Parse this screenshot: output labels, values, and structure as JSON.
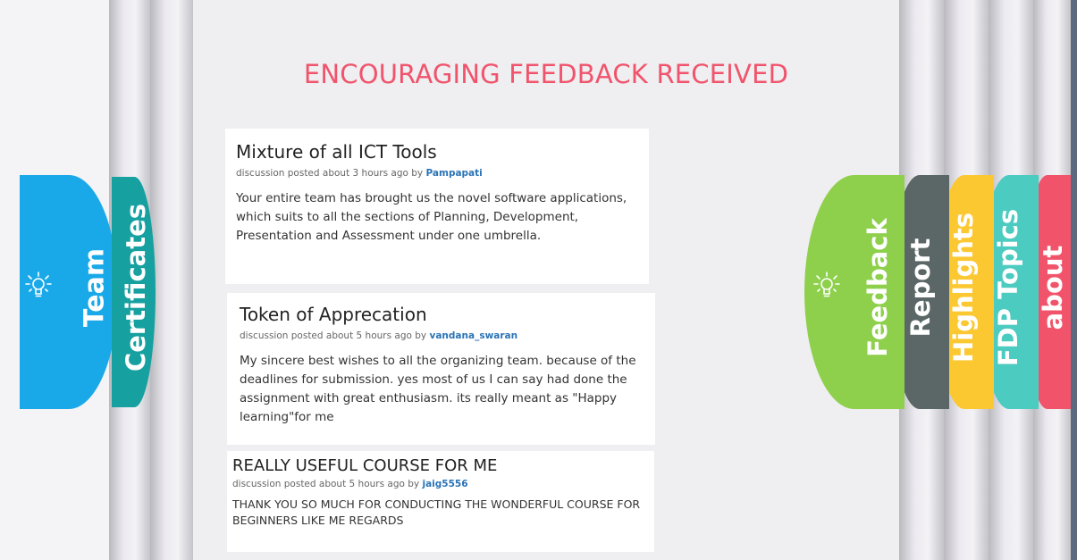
{
  "page": {
    "title": "ENCOURAGING FEEDBACK RECEIVED"
  },
  "left_tabs": [
    {
      "label": "Team",
      "color": "#1aa9e8",
      "icon": "lightbulb-icon"
    },
    {
      "label": "Certificates",
      "color": "#17a0a0"
    }
  ],
  "right_tabs": [
    {
      "label": "Feedback",
      "color": "#8ed04b",
      "icon": "lightbulb-icon"
    },
    {
      "label": "Report",
      "color": "#5b6766"
    },
    {
      "label": "Highlights",
      "color": "#fcc832"
    },
    {
      "label": "FDP Topics",
      "color": "#4ccbc0"
    },
    {
      "label": "about",
      "color": "#f1546a"
    }
  ],
  "feedback": [
    {
      "title": "Mixture of all ICT Tools",
      "meta_prefix": "discussion posted about 3 hours ago by",
      "author": "Pampapati",
      "body": "Your entire team has brought us the novel software applications, which suits to all the sections of Planning, Development, Presentation and Assessment under one umbrella."
    },
    {
      "title": "Token of Apprecation",
      "meta_prefix": "discussion posted about 5 hours ago by",
      "author": "vandana_swaran",
      "body": "My sincere best wishes to all the organizing team. because of the deadlines for submission. yes most of us I can say had done the assignment with great enthusiasm. its really meant as \"Happy learning\"for me"
    },
    {
      "title": "REALLY USEFUL COURSE FOR ME",
      "meta_prefix": "discussion posted about 5 hours ago by",
      "author": "jaig5556",
      "body": "THANK YOU SO MUCH FOR CONDUCTING THE WONDERFUL COURSE FOR BEGINNERS LIKE ME REGARDS"
    }
  ]
}
